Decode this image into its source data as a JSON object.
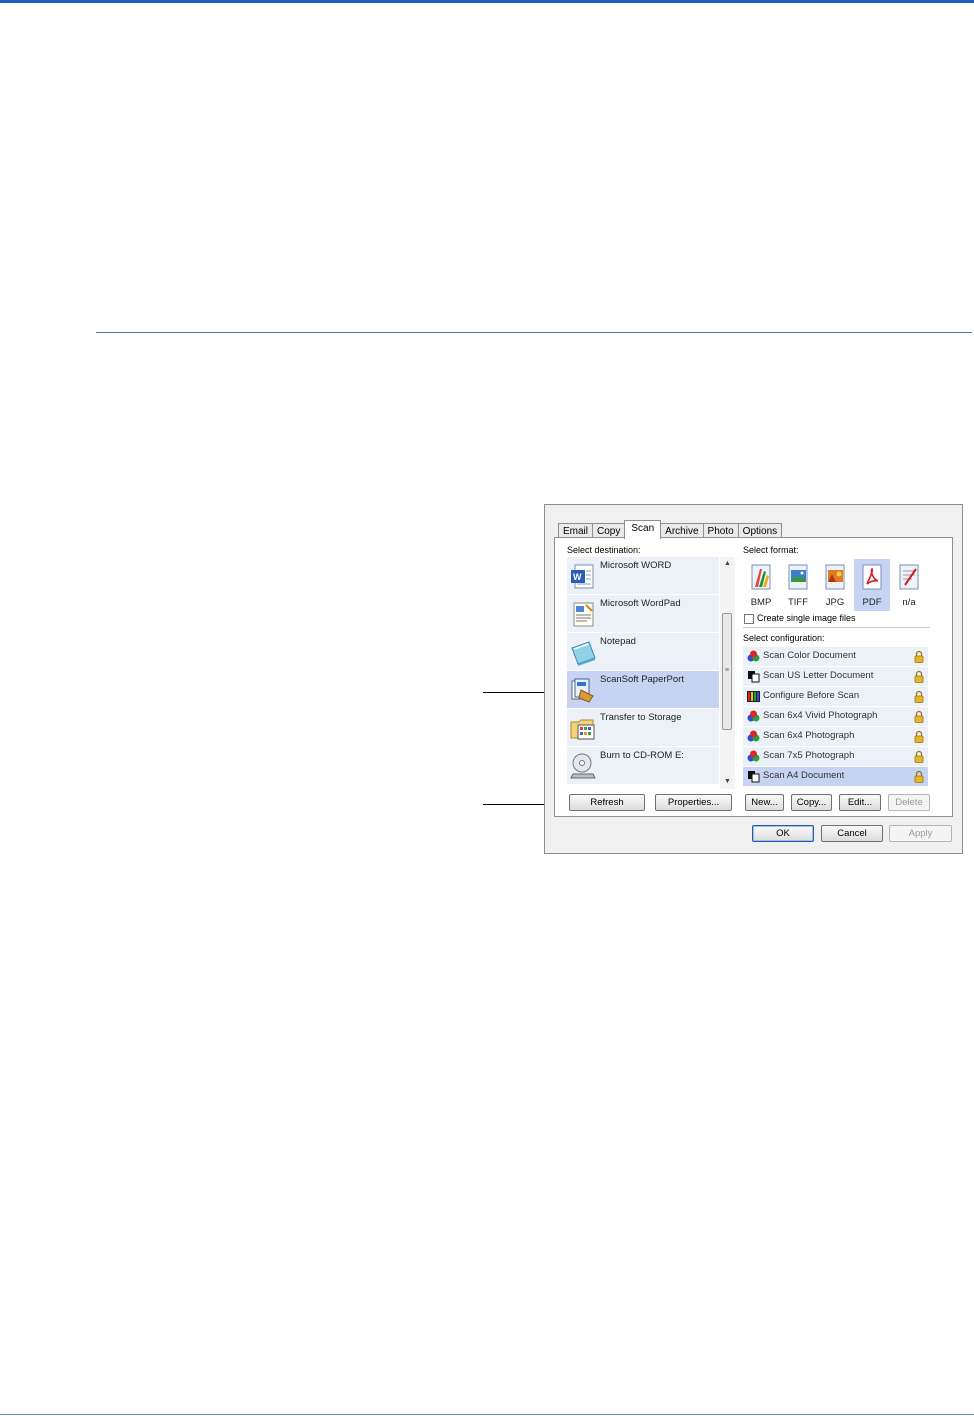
{
  "dialog": {
    "tabs": [
      "Email",
      "Copy",
      "Scan",
      "Archive",
      "Photo",
      "Options"
    ],
    "active_tab": "Scan",
    "select_destination_label": "Select destination:",
    "destinations": [
      {
        "label": "Microsoft WORD",
        "icon": "word-icon",
        "selected": false
      },
      {
        "label": "Microsoft WordPad",
        "icon": "wordpad-icon",
        "selected": false
      },
      {
        "label": "Notepad",
        "icon": "notepad-icon",
        "selected": false
      },
      {
        "label": "ScanSoft PaperPort",
        "icon": "paperport-icon",
        "selected": true
      },
      {
        "label": "Transfer to Storage",
        "icon": "storage-folder-icon",
        "selected": false
      },
      {
        "label": "Burn to CD-ROM  E:",
        "icon": "cd-rom-icon",
        "selected": false
      }
    ],
    "select_format_label": "Select format:",
    "formats": [
      {
        "label": "BMP",
        "icon": "bmp-format-icon",
        "selected": false
      },
      {
        "label": "TIFF",
        "icon": "tiff-format-icon",
        "selected": false
      },
      {
        "label": "JPG",
        "icon": "jpg-format-icon",
        "selected": false
      },
      {
        "label": "PDF",
        "icon": "pdf-format-icon",
        "selected": true
      },
      {
        "label": "n/a",
        "icon": "text-format-icon",
        "selected": false
      }
    ],
    "single_image_checkbox_label": "Create single image files",
    "select_configuration_label": "Select configuration:",
    "configurations": [
      {
        "label": "Scan Color Document",
        "icon": "color-config-icon",
        "selected": false
      },
      {
        "label": "Scan US Letter Document",
        "icon": "bw-config-icon",
        "selected": false
      },
      {
        "label": "Configure Before Scan",
        "icon": "configure-before-scan-icon",
        "selected": false
      },
      {
        "label": "Scan 6x4 Vivid Photograph",
        "icon": "color-config-icon",
        "selected": false
      },
      {
        "label": "Scan 6x4 Photograph",
        "icon": "color-config-icon",
        "selected": false
      },
      {
        "label": "Scan 7x5 Photograph",
        "icon": "color-config-icon",
        "selected": false
      },
      {
        "label": "Scan A4 Document",
        "icon": "bw-config-icon",
        "selected": true
      }
    ],
    "buttons": {
      "refresh": "Refresh",
      "properties": "Properties...",
      "new": "New...",
      "copy": "Copy...",
      "edit": "Edit...",
      "delete": "Delete",
      "ok": "OK",
      "cancel": "Cancel",
      "apply": "Apply"
    },
    "colors": {
      "selection": "#c6d3f2",
      "item_background": "#ecf1f8",
      "header_rule": "#1f5fb8",
      "lock": "#e8b52a"
    }
  }
}
